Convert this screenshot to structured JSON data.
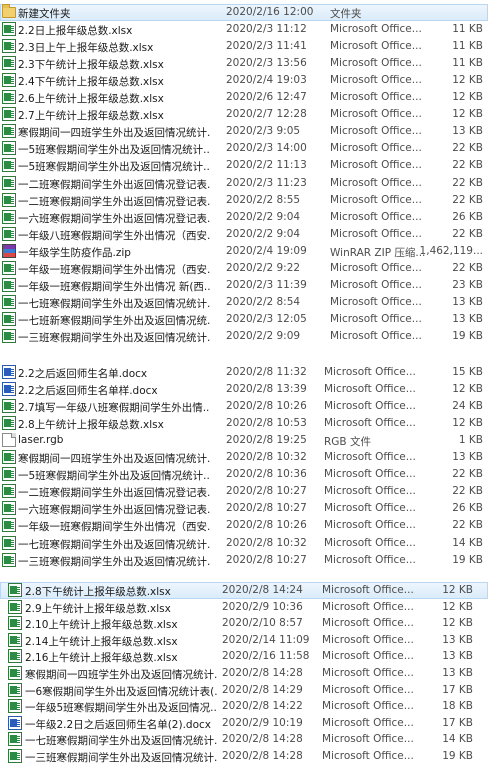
{
  "groups": [
    {
      "rows": [
        {
          "icon": "folder-icon",
          "name": "新建文件夹",
          "date": "2020/2/16 12:00",
          "type": "文件夹",
          "size": "",
          "selected": true
        },
        {
          "icon": "excel-file-icon",
          "name": "2.2日上报年级总数.xlsx",
          "date": "2020/2/3 11:12",
          "type": "Microsoft Office...",
          "size": "11 KB"
        },
        {
          "icon": "excel-file-icon",
          "name": "2.3日上午上报年级总数.xlsx",
          "date": "2020/2/3 11:41",
          "type": "Microsoft Office...",
          "size": "11 KB"
        },
        {
          "icon": "excel-file-icon",
          "name": "2.3下午统计上报年级总数.xlsx",
          "date": "2020/2/3 13:56",
          "type": "Microsoft Office...",
          "size": "11 KB"
        },
        {
          "icon": "excel-file-icon",
          "name": "2.4下午统计上报年级总数.xlsx",
          "date": "2020/2/4 19:03",
          "type": "Microsoft Office...",
          "size": "12 KB"
        },
        {
          "icon": "excel-file-icon",
          "name": "2.6上午统计上报年级总数.xlsx",
          "date": "2020/2/6 12:47",
          "type": "Microsoft Office...",
          "size": "12 KB"
        },
        {
          "icon": "excel-file-icon",
          "name": "2.7上午统计上报年级总数.xlsx",
          "date": "2020/2/7 12:28",
          "type": "Microsoft Office...",
          "size": "12 KB"
        },
        {
          "icon": "excel-file-icon",
          "name": "寒假期间一四班学生外出及返回情况统计...",
          "date": "2020/2/3 9:05",
          "type": "Microsoft Office...",
          "size": "13 KB"
        },
        {
          "icon": "excel-file-icon",
          "name": "一5班寒假期间学生外出及返回情况统计...",
          "date": "2020/2/3 14:00",
          "type": "Microsoft Office...",
          "size": "22 KB"
        },
        {
          "icon": "excel-file-icon",
          "name": "一5班寒假期间学生外出及返回情况统计...",
          "date": "2020/2/2 11:13",
          "type": "Microsoft Office...",
          "size": "22 KB"
        },
        {
          "icon": "excel-file-icon",
          "name": "一二班寒假期间学生外出返回情况登记表...",
          "date": "2020/2/3 11:23",
          "type": "Microsoft Office...",
          "size": "22 KB"
        },
        {
          "icon": "excel-file-icon",
          "name": "一二班寒假期间学生外出返回情况登记表...",
          "date": "2020/2/2 8:55",
          "type": "Microsoft Office...",
          "size": "22 KB"
        },
        {
          "icon": "excel-file-icon",
          "name": "一六班寒假期间学生外出返回情况登记表...",
          "date": "2020/2/2 9:04",
          "type": "Microsoft Office...",
          "size": "26 KB"
        },
        {
          "icon": "excel-file-icon",
          "name": "一年级八班寒假期间学生外出情况（西安...",
          "date": "2020/2/2 9:04",
          "type": "Microsoft Office...",
          "size": "22 KB"
        },
        {
          "icon": "zip-archive-icon",
          "name": "一年级学生防疫作品.zip",
          "date": "2020/2/4 19:09",
          "type": "WinRAR ZIP 压缩...",
          "size": "1,462,119..."
        },
        {
          "icon": "excel-file-icon",
          "name": "一年级一班寒假期间学生外出情况（西安...",
          "date": "2020/2/2 9:22",
          "type": "Microsoft Office...",
          "size": "22 KB"
        },
        {
          "icon": "excel-file-icon",
          "name": "一年级一班寒假期间学生外出情况 新(西...",
          "date": "2020/2/3 11:39",
          "type": "Microsoft Office...",
          "size": "23 KB"
        },
        {
          "icon": "excel-file-icon",
          "name": "一七班寒假期间学生外出及返回情况统计...",
          "date": "2020/2/2 8:54",
          "type": "Microsoft Office...",
          "size": "13 KB"
        },
        {
          "icon": "excel-file-icon",
          "name": "一七班新寒假期间学生外出及返回情况统...",
          "date": "2020/2/3 12:05",
          "type": "Microsoft Office...",
          "size": "13 KB"
        },
        {
          "icon": "excel-file-icon",
          "name": "一三班寒假期间学生外出及返回情况统计...",
          "date": "2020/2/2 9:09",
          "type": "Microsoft Office...",
          "size": "19 KB"
        }
      ]
    },
    {
      "rows": [
        {
          "icon": "word-file-icon",
          "name": "2.2之后返回师生名单.docx",
          "date": "2020/2/8 11:32",
          "type": "Microsoft Office...",
          "size": "15 KB"
        },
        {
          "icon": "word-file-icon",
          "name": "2.2之后返回师生名单样.docx",
          "date": "2020/2/8 13:39",
          "type": "Microsoft Office...",
          "size": "12 KB"
        },
        {
          "icon": "excel-file-icon",
          "name": "2.7填写一年级八班寒假期间学生外出情...",
          "date": "2020/2/8 10:26",
          "type": "Microsoft Office...",
          "size": "24 KB"
        },
        {
          "icon": "excel-file-icon",
          "name": "2.8上午统计上报年级总数.xlsx",
          "date": "2020/2/8 10:53",
          "type": "Microsoft Office...",
          "size": "12 KB"
        },
        {
          "icon": "generic-file-icon",
          "name": "laser.rgb",
          "date": "2020/2/8 19:25",
          "type": "RGB 文件",
          "size": "1 KB"
        },
        {
          "icon": "excel-file-icon",
          "name": "寒假期间一四班学生外出及返回情况统计...",
          "date": "2020/2/8 10:32",
          "type": "Microsoft Office...",
          "size": "13 KB"
        },
        {
          "icon": "excel-file-icon",
          "name": "一5班寒假期间学生外出及返回情况统计...",
          "date": "2020/2/8 10:36",
          "type": "Microsoft Office...",
          "size": "22 KB"
        },
        {
          "icon": "excel-file-icon",
          "name": "一二班寒假期间学生外出返回情况登记表...",
          "date": "2020/2/8 10:27",
          "type": "Microsoft Office...",
          "size": "22 KB"
        },
        {
          "icon": "excel-file-icon",
          "name": "一六班寒假期间学生外出返回情况登记表...",
          "date": "2020/2/8 10:27",
          "type": "Microsoft Office...",
          "size": "26 KB"
        },
        {
          "icon": "excel-file-icon",
          "name": "一年级一班寒假期间学生外出情况（西安...",
          "date": "2020/2/8 10:26",
          "type": "Microsoft Office...",
          "size": "22 KB"
        },
        {
          "icon": "excel-file-icon",
          "name": "一七班寒假期间学生外出及返回情况统计...",
          "date": "2020/2/8 10:32",
          "type": "Microsoft Office...",
          "size": "14 KB"
        },
        {
          "icon": "excel-file-icon",
          "name": "一三班寒假期间学生外出及返回情况统计...",
          "date": "2020/2/8 10:27",
          "type": "Microsoft Office...",
          "size": "19 KB"
        }
      ]
    },
    {
      "rows": [
        {
          "icon": "excel-file-icon",
          "name": "2.8下午统计上报年级总数.xlsx",
          "date": "2020/2/8 14:24",
          "type": "Microsoft Office...",
          "size": "12 KB",
          "selected": true
        },
        {
          "icon": "excel-file-icon",
          "name": "2.9上午统计上报年级总数.xlsx",
          "date": "2020/2/9 10:36",
          "type": "Microsoft Office...",
          "size": "12 KB"
        },
        {
          "icon": "excel-file-icon",
          "name": "2.10上午统计上报年级总数.xlsx",
          "date": "2020/2/10 8:57",
          "type": "Microsoft Office...",
          "size": "12 KB"
        },
        {
          "icon": "excel-file-icon",
          "name": "2.14上午统计上报年级总数.xlsx",
          "date": "2020/2/14 11:09",
          "type": "Microsoft Office...",
          "size": "13 KB"
        },
        {
          "icon": "excel-file-icon",
          "name": "2.16上午统计上报年级总数.xlsx",
          "date": "2020/2/16 11:58",
          "type": "Microsoft Office...",
          "size": "13 KB"
        },
        {
          "icon": "excel-file-icon",
          "name": "寒假期间一四班学生外出及返回情况统计...",
          "date": "2020/2/8 14:28",
          "type": "Microsoft Office...",
          "size": "13 KB"
        },
        {
          "icon": "excel-file-icon",
          "name": "一6寒假期间学生外出及返回情况统计表(...",
          "date": "2020/2/8 14:29",
          "type": "Microsoft Office...",
          "size": "17 KB"
        },
        {
          "icon": "excel-file-icon",
          "name": "一年级5班寒假期间学生外出及返回情况...",
          "date": "2020/2/8 14:22",
          "type": "Microsoft Office...",
          "size": "18 KB"
        },
        {
          "icon": "word-file-icon",
          "name": "一年级2.2日之后返回师生名单(2).docx",
          "date": "2020/2/9 10:19",
          "type": "Microsoft Office...",
          "size": "17 KB"
        },
        {
          "icon": "excel-file-icon",
          "name": "一七班寒假期间学生外出及返回情况统计...",
          "date": "2020/2/8 14:28",
          "type": "Microsoft Office...",
          "size": "14 KB"
        },
        {
          "icon": "excel-file-icon",
          "name": "一三班寒假期间学生外出及返回情况统计...",
          "date": "2020/2/8 14:28",
          "type": "Microsoft Office...",
          "size": "19 KB"
        }
      ]
    }
  ]
}
